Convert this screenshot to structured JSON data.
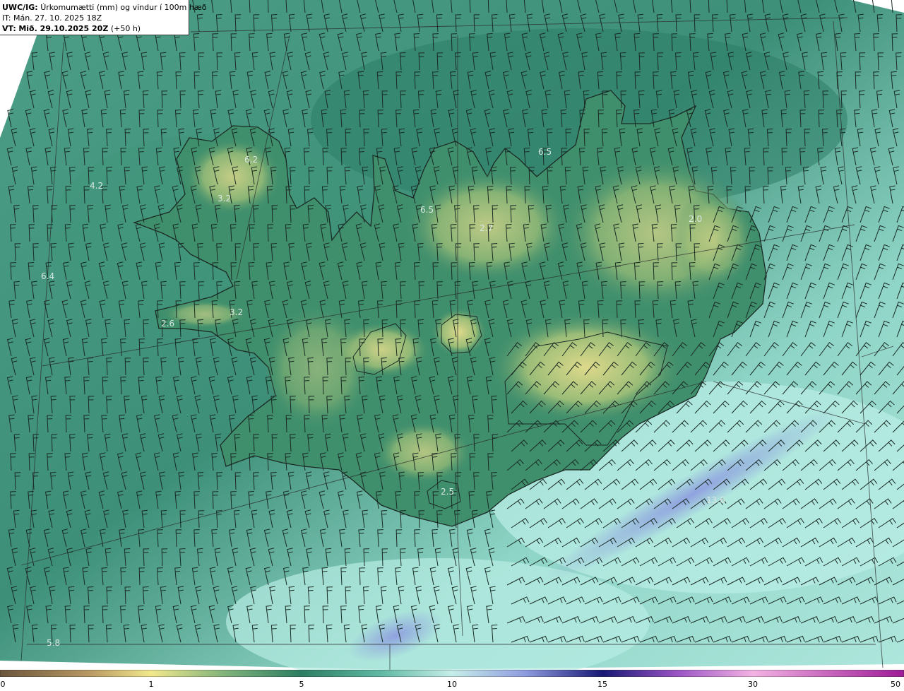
{
  "header": {
    "model": "UWC/IG:",
    "title": "Úrkomumætti (mm) og vindur í 100m hæð",
    "init_time": "IT: Mán. 27. 10. 2025 18Z",
    "valid_prefix": "VT:",
    "valid_time": "Mið. 29.10.2025 20Z",
    "lead": "(+50 h)"
  },
  "map_labels": [
    {
      "text": "6.2",
      "name": "vestfirdir-north"
    },
    {
      "text": "4.2",
      "name": "west-sea"
    },
    {
      "text": "3.2",
      "name": "vestfirdir-south"
    },
    {
      "text": "6.4",
      "name": "far-west-sea"
    },
    {
      "text": "3.2",
      "name": "snaefellsnes"
    },
    {
      "text": "2.6",
      "name": "snaefellsnes-tip"
    },
    {
      "text": "6.5",
      "name": "north-coast-east"
    },
    {
      "text": "6.5",
      "name": "north-coast-mid"
    },
    {
      "text": "2.7",
      "name": "north-interior"
    },
    {
      "text": "2.0",
      "name": "east-highlands"
    },
    {
      "text": "2.5",
      "name": "south-coast"
    },
    {
      "text": "13.6",
      "name": "southeast-sea"
    },
    {
      "text": "5.8",
      "name": "southwest-sea"
    }
  ],
  "colorbar": {
    "ticks": [
      "0",
      "1",
      "5",
      "10",
      "15",
      "30",
      "50"
    ],
    "colors": [
      "#6f5a3e",
      "#c9a66b",
      "#f3e98a",
      "#2f8e6f",
      "#1f6a55",
      "#8fd8cc",
      "#c6eee8",
      "#7f8ed8",
      "#1a1a7a",
      "#c06ad0",
      "#f0b0e0",
      "#a0209a"
    ]
  }
}
